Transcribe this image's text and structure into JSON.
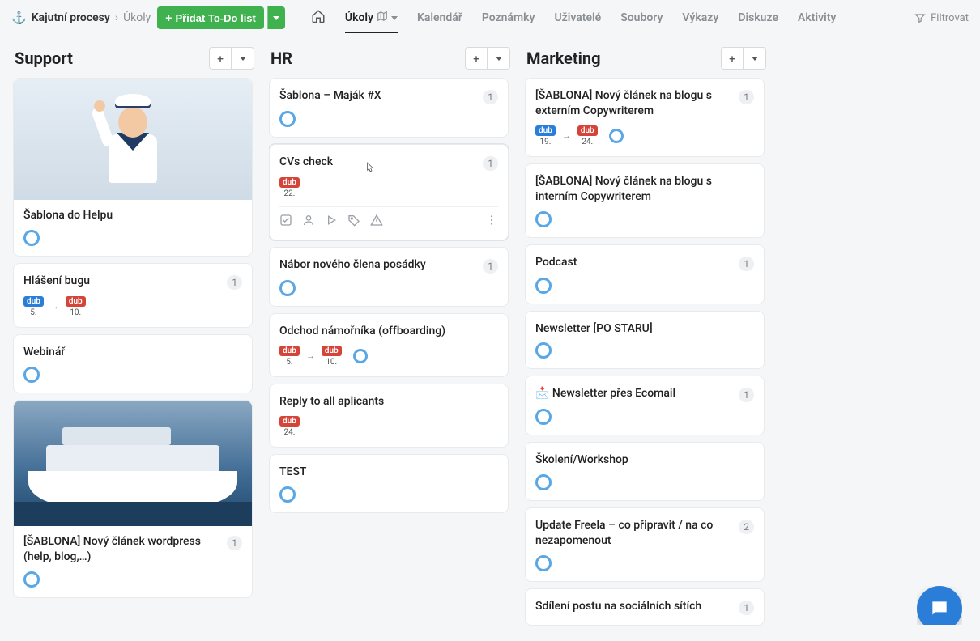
{
  "breadcrumb": {
    "anchor": "⚓",
    "main": "Kajutní procesy",
    "sub": "Úkoly"
  },
  "add_button": {
    "label": "Přidat To-Do list"
  },
  "nav": {
    "items": [
      "Úkoly",
      "Kalendář",
      "Poznámky",
      "Uživatelé",
      "Soubory",
      "Výkazy",
      "Diskuze",
      "Aktivity"
    ],
    "active_index": 0,
    "filter_label": "Filtrovat"
  },
  "month_abbr": "dub",
  "columns": [
    {
      "title": "Support",
      "cards": [
        {
          "title": "Šablona do Helpu",
          "image": "sailor",
          "status_ring": true
        },
        {
          "title": "Hlášení bugu",
          "count": "1",
          "dates": {
            "from_color": "blue",
            "from_day": "5.",
            "to_color": "red",
            "to_day": "10."
          }
        },
        {
          "title": "Webinář",
          "status_ring": true
        },
        {
          "title": "[ŠABLONA] Nový článek wordpress (help, blog,…)",
          "image": "ship",
          "count": "1",
          "status_ring": true
        }
      ]
    },
    {
      "title": "HR",
      "cards": [
        {
          "title": "Šablona – Maják #X",
          "count": "1",
          "status_ring": true
        },
        {
          "title": "CVs check",
          "count": "1",
          "single_date": {
            "color": "red",
            "day": "22."
          },
          "hover_toolbar": true,
          "cursor": true
        },
        {
          "title": "Nábor nového člena posádky",
          "count": "1",
          "status_ring": true
        },
        {
          "title": "Odchod námořníka (offboarding)",
          "dates": {
            "from_color": "red",
            "from_day": "5.",
            "to_color": "red",
            "to_day": "10."
          },
          "status_ring_inline": true
        },
        {
          "title": "Reply to all aplicants",
          "single_date": {
            "color": "red",
            "day": "24."
          }
        },
        {
          "title": "TEST",
          "status_ring": true
        }
      ]
    },
    {
      "title": "Marketing",
      "cards": [
        {
          "title": "[ŠABLONA] Nový článek na blogu s externím Copywriterem",
          "count": "1",
          "dates": {
            "from_color": "blue",
            "from_day": "19.",
            "to_color": "red",
            "to_day": "24."
          },
          "status_ring_inline": true
        },
        {
          "title": "[ŠABLONA] Nový článek na blogu s interním Copywriterem",
          "status_ring": true
        },
        {
          "title": "Podcast",
          "count": "1",
          "status_ring": true
        },
        {
          "title": "Newsletter [PO STARU]",
          "status_ring": true
        },
        {
          "title": "📩 Newsletter přes Ecomail",
          "count": "1",
          "status_ring": true
        },
        {
          "title": "Školení/Workshop",
          "status_ring": true
        },
        {
          "title": "Update Freela – co připravit / na co nezapomenout",
          "count": "2",
          "status_ring": true
        },
        {
          "title": "Sdílení postu na sociálních sítích",
          "count": "1"
        }
      ]
    }
  ]
}
